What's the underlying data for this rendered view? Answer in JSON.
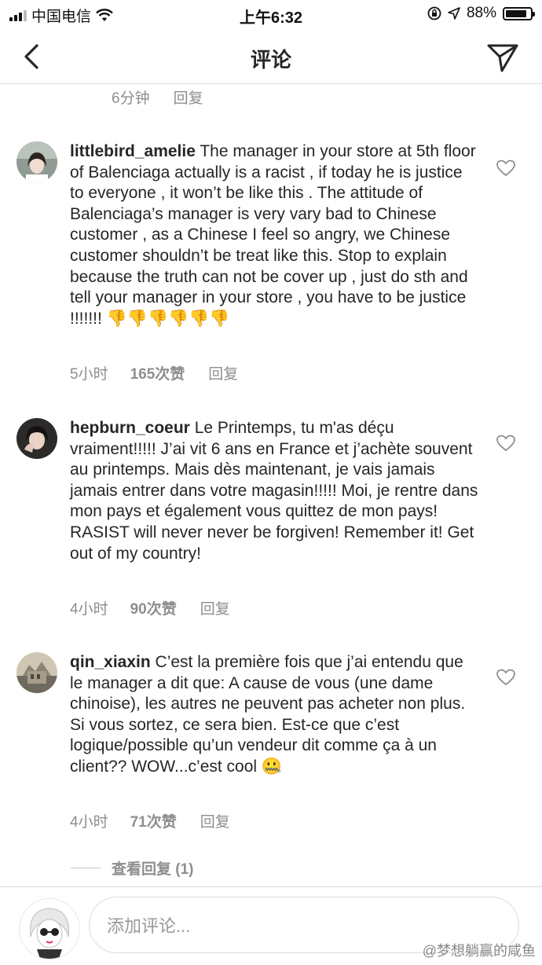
{
  "status_bar": {
    "carrier": "中国电信",
    "time": "上午6:32",
    "battery_percent": "88%",
    "battery_level": 0.88
  },
  "nav": {
    "title": "评论"
  },
  "top_meta": {
    "time": "6分钟",
    "reply": "回复"
  },
  "comments": [
    {
      "username": "littlebird_amelie",
      "text": "The manager in your store at 5th floor of Balenciaga actually is a racist , if today he is justice to everyone , it won’t be like this . The attitude of Balenciaga’s manager is very vary bad to Chinese customer , as a Chinese I feel so angry, we Chinese customer shouldn’t be treat like this. Stop to explain because the truth can not be cover up , just do sth and tell your manager in your store , you have to be justice !!!!!!!",
      "emoji": "👎👎👎👎👎👎",
      "time": "5小时",
      "likes": "165次赞",
      "reply": "回复"
    },
    {
      "username": "hepburn_coeur",
      "text": "Le Printemps, tu m'as déçu vraiment!!!!! J’ai vit 6 ans en France et j’achète souvent au printemps. Mais dès maintenant, je vais jamais jamais entrer dans votre magasin!!!!! Moi, je rentre dans mon pays et également vous quittez de mon pays! RASIST will never never be forgiven! Remember it! Get out of my country!",
      "emoji": "",
      "time": "4小时",
      "likes": "90次赞",
      "reply": "回复"
    },
    {
      "username": "qin_xiaxin",
      "text": "C’est la première fois que j’ai entendu que le manager a dit que: A cause de vous (une dame chinoise), les autres ne peuvent pas acheter non plus. Si vous sortez, ce sera bien. Est-ce que c’est logique/possible qu’un vendeur dit comme ça à un client?? WOW...c’est cool",
      "emoji": "🤐",
      "time": "4小时",
      "likes": "71次赞",
      "reply": "回复"
    }
  ],
  "view_replies": "查看回复 (1)",
  "composer": {
    "placeholder": "添加评论..."
  },
  "watermark": "@梦想躺赢的咸鱼",
  "colors": {
    "text": "#262626",
    "muted": "#8e8e8e",
    "divider": "#dbdbdb"
  },
  "icons": [
    "back-icon",
    "send-icon",
    "heart-icon",
    "signal-icon",
    "wifi-icon",
    "lock-rotation-icon",
    "location-icon",
    "battery-icon"
  ]
}
